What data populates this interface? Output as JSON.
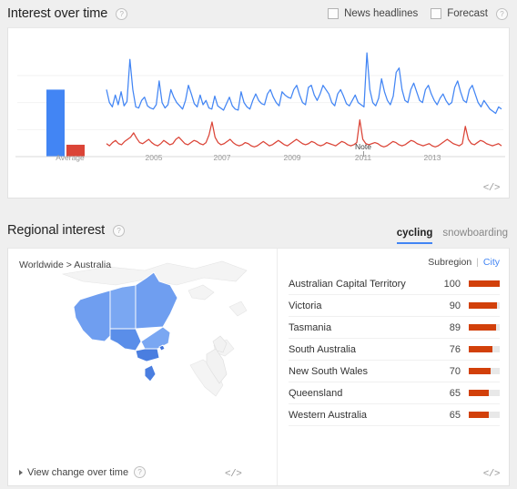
{
  "interest_over_time": {
    "title": "Interest over time",
    "help_icon": "help-icon",
    "news_headlines_label": "News headlines",
    "news_headlines_checked": false,
    "forecast_label": "Forecast",
    "forecast_checked": false,
    "embed_label": "</>",
    "note_label": "Note"
  },
  "regional_interest": {
    "title": "Regional interest",
    "help_icon": "help-icon",
    "tabs": [
      {
        "label": "cycling",
        "active": true
      },
      {
        "label": "snowboarding",
        "active": false
      }
    ],
    "breadcrumb": "Worldwide > Australia",
    "view_change_label": "View change over time",
    "subregion_label": "Subregion",
    "city_label": "City",
    "subregion_active": true,
    "embed_label": "</>",
    "map_embed_label": "</>",
    "regions": [
      {
        "name": "Australian Capital Territory",
        "value": 100
      },
      {
        "name": "Victoria",
        "value": 90
      },
      {
        "name": "Tasmania",
        "value": 89
      },
      {
        "name": "South Australia",
        "value": 76
      },
      {
        "name": "New South Wales",
        "value": 70
      },
      {
        "name": "Queensland",
        "value": 65
      },
      {
        "name": "Western Australia",
        "value": 65
      }
    ]
  },
  "chart_data": {
    "type": "line",
    "title": "Interest over time",
    "xlabel": "",
    "ylabel": "",
    "ylim": [
      0,
      100
    ],
    "grid": true,
    "legend": "none",
    "axis_ticks": [
      "Average",
      "2005",
      "2007",
      "2009",
      "2011",
      "2013"
    ],
    "annotations": [
      {
        "label": "Note",
        "x_tick": "2011"
      }
    ],
    "average_bars": {
      "category": "Average",
      "series": [
        {
          "name": "cycling",
          "value": 62,
          "color": "#4285f4"
        },
        {
          "name": "snowboarding",
          "value": 11,
          "color": "#db4437"
        }
      ]
    },
    "series": [
      {
        "name": "cycling",
        "color": "#4285f4",
        "values": [
          62,
          50,
          46,
          57,
          48,
          60,
          47,
          51,
          90,
          62,
          46,
          45,
          52,
          55,
          47,
          45,
          44,
          48,
          70,
          50,
          45,
          48,
          62,
          55,
          50,
          47,
          44,
          52,
          66,
          58,
          49,
          46,
          57,
          48,
          52,
          45,
          44,
          56,
          47,
          45,
          43,
          49,
          55,
          47,
          44,
          43,
          60,
          50,
          46,
          44,
          52,
          58,
          52,
          49,
          48,
          58,
          62,
          55,
          50,
          47,
          60,
          57,
          55,
          54,
          62,
          66,
          57,
          50,
          48,
          64,
          66,
          57,
          52,
          58,
          66,
          62,
          58,
          50,
          47,
          58,
          62,
          56,
          49,
          47,
          52,
          57,
          50,
          48,
          46,
          96,
          62,
          50,
          47,
          54,
          72,
          60,
          52,
          48,
          56,
          78,
          82,
          62,
          52,
          50,
          62,
          68,
          60,
          52,
          50,
          62,
          66,
          58,
          52,
          48,
          54,
          58,
          52,
          48,
          50,
          64,
          70,
          60,
          52,
          50,
          62,
          66,
          58,
          50,
          46,
          52,
          48,
          44,
          42,
          40,
          46,
          44
        ]
      },
      {
        "name": "snowboarding",
        "color": "#db4437",
        "values": [
          12,
          10,
          13,
          15,
          12,
          11,
          14,
          16,
          18,
          22,
          17,
          13,
          12,
          14,
          16,
          13,
          11,
          10,
          12,
          15,
          13,
          11,
          12,
          16,
          18,
          15,
          12,
          11,
          13,
          15,
          14,
          12,
          11,
          13,
          20,
          32,
          18,
          13,
          11,
          12,
          14,
          16,
          13,
          11,
          10,
          11,
          13,
          12,
          10,
          9,
          10,
          12,
          14,
          12,
          10,
          11,
          13,
          15,
          13,
          11,
          10,
          12,
          14,
          16,
          14,
          12,
          11,
          12,
          14,
          13,
          11,
          10,
          11,
          13,
          12,
          11,
          10,
          12,
          14,
          13,
          11,
          10,
          11,
          13,
          34,
          16,
          12,
          11,
          12,
          13,
          12,
          10,
          9,
          10,
          12,
          14,
          13,
          11,
          10,
          11,
          13,
          15,
          14,
          12,
          11,
          10,
          11,
          12,
          10,
          9,
          10,
          12,
          14,
          16,
          14,
          12,
          11,
          10,
          12,
          28,
          16,
          12,
          11,
          13,
          15,
          14,
          12,
          11,
          10,
          11,
          12,
          10
        ]
      }
    ]
  }
}
